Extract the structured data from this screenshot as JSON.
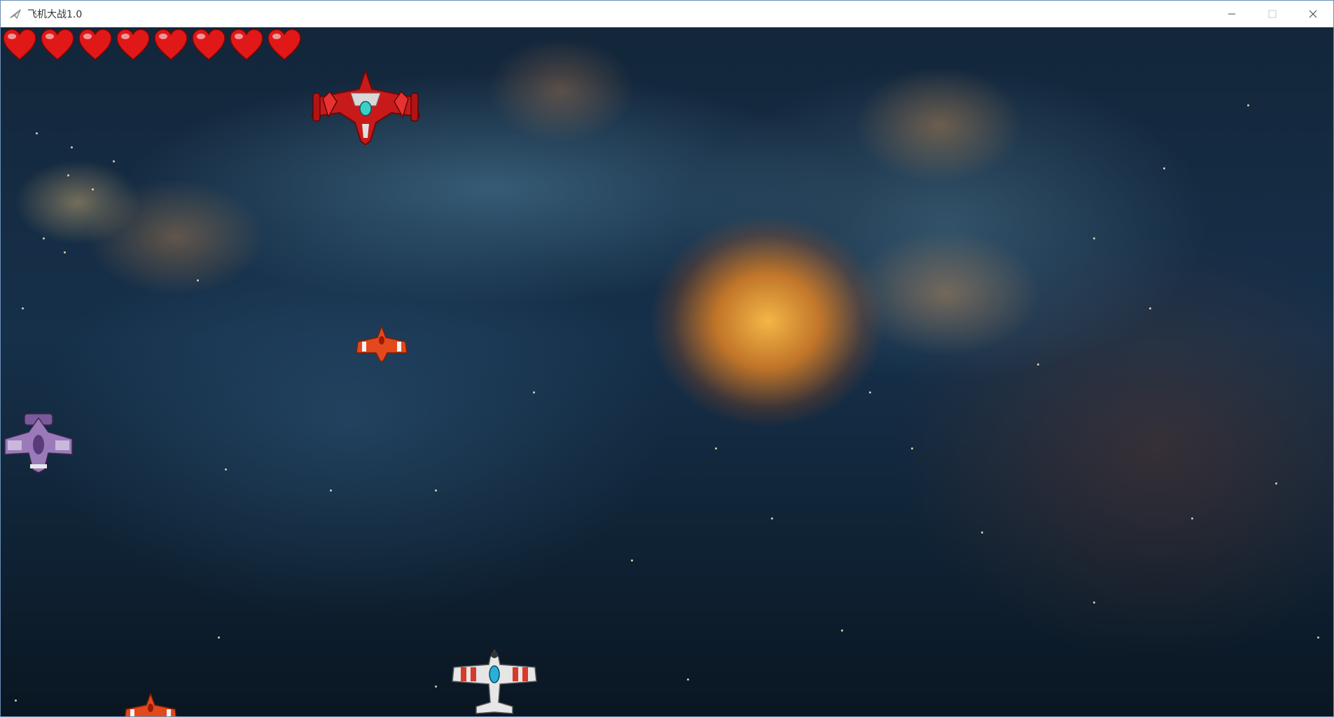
{
  "window": {
    "title": "飞机大战1.0",
    "controls": {
      "minimize": "minimize-icon",
      "maximize": "maximize-icon",
      "close": "close-icon"
    }
  },
  "hud": {
    "lives": 8,
    "life_icon": "heart-icon",
    "life_color": "#e01818"
  },
  "game": {
    "background": "space-nebula",
    "player": {
      "icon": "player-plane-icon",
      "colors": [
        "#e0e0e0",
        "#d63a2a"
      ]
    },
    "enemies": [
      {
        "type": "boss",
        "icon": "enemy-boss-plane-icon",
        "color": "#c81a1a"
      },
      {
        "type": "small",
        "icon": "enemy-small-plane-icon",
        "color": "#e2491c"
      },
      {
        "type": "medium",
        "icon": "enemy-medium-plane-icon",
        "color": "#8a6aa8"
      },
      {
        "type": "small",
        "icon": "enemy-small-plane-icon",
        "color": "#e2491c"
      }
    ]
  }
}
